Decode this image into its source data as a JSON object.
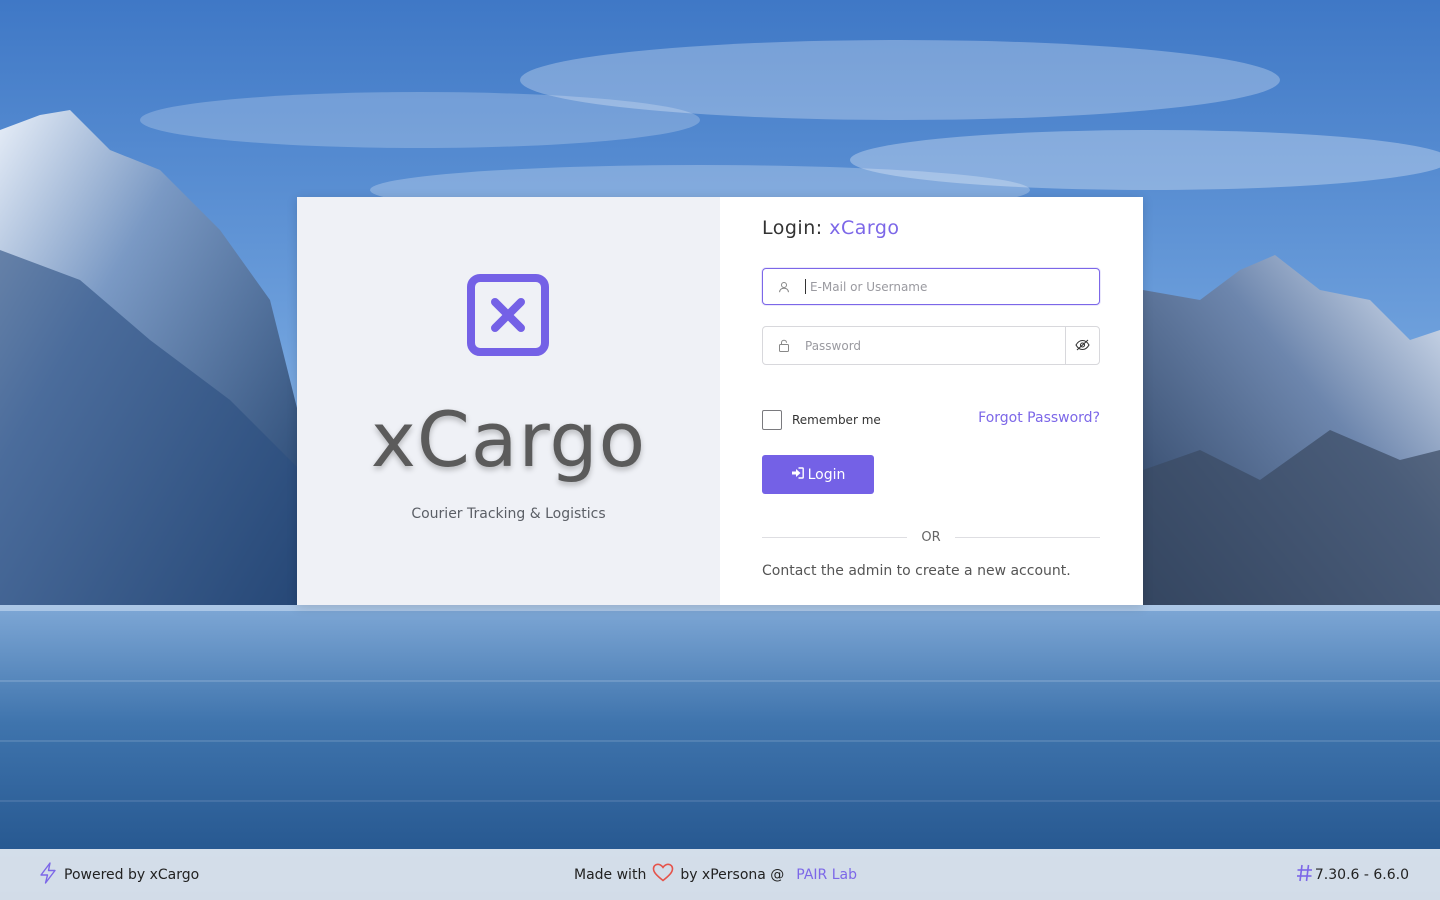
{
  "app": {
    "title": "xCargo"
  },
  "branding": {
    "name": "xCargo",
    "tagline": "Courier Tracking & Logistics"
  },
  "login": {
    "title_prefix": "Login:",
    "title_app": "xCargo",
    "email_placeholder": "E-Mail or Username",
    "password_placeholder": "Password",
    "remember_label": "Remember me",
    "forgot_label": "Forgot Password?",
    "submit_label": "Login",
    "divider_text": "OR",
    "contact_text": "Contact the admin to create a new account."
  },
  "footer": {
    "powered_text": "Powered by xCargo",
    "made_with": "Made with",
    "by_text": "by xPersona @",
    "lab_link": "PAIR Lab",
    "version": "7.30.6 - 6.6.0"
  },
  "icons": {
    "logo": "x-square-icon",
    "user": "user-icon",
    "lock": "lock-icon",
    "eye": "eye-off-icon",
    "sign_in": "sign-in-icon",
    "bolt": "bolt-icon",
    "heart": "heart-icon",
    "hash": "hash-icon"
  },
  "colors": {
    "accent": "#7461e6",
    "link": "#7c67e8",
    "heart": "#e5534b"
  }
}
